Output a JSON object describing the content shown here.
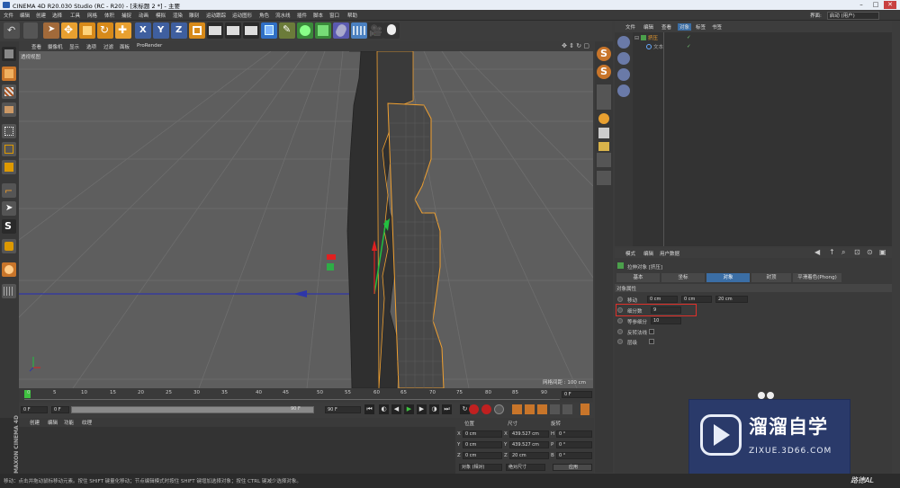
{
  "window": {
    "title": "CINEMA 4D R20.030 Studio (RC - R20) - [未标题 2 *] - 主要"
  },
  "menu": [
    "文件",
    "编辑",
    "创建",
    "选择",
    "工具",
    "网格",
    "体积",
    "捕捉",
    "动画",
    "模拟",
    "渲染",
    "雕刻",
    "运动跟踪",
    "运动图形",
    "角色",
    "流水线",
    "插件",
    "脚本",
    "窗口",
    "帮助"
  ],
  "layout": {
    "label": "界面:",
    "value": "启动 (用户)"
  },
  "viewport": {
    "menu": [
      "查看",
      "摄像机",
      "显示",
      "选项",
      "过滤",
      "面板",
      "ProRender"
    ],
    "label": "透视视图",
    "scale": "网格间距 : 100 cm"
  },
  "timeline": {
    "ticks": [
      "0",
      "5",
      "10",
      "15",
      "20",
      "25",
      "30",
      "35",
      "40",
      "45",
      "50",
      "55",
      "60",
      "65",
      "70",
      "75",
      "80",
      "85",
      "90"
    ],
    "end_frame": "0 F"
  },
  "transport": {
    "start": "0 F",
    "current": "0 F",
    "end": "90 F",
    "end2": "90 F"
  },
  "material": {
    "menu": [
      "创建",
      "编辑",
      "功能",
      "纹理"
    ]
  },
  "coords": {
    "headers": [
      "位置",
      "尺寸",
      "旋转"
    ],
    "rows": [
      {
        "axis": "X",
        "pos": "0 cm",
        "size": "439.527 cm",
        "rot_axis": "H",
        "rot": "0 °"
      },
      {
        "axis": "Y",
        "pos": "0 cm",
        "size": "439.527 cm",
        "rot_axis": "P",
        "rot": "0 °"
      },
      {
        "axis": "Z",
        "pos": "0 cm",
        "size": "20 cm",
        "rot_axis": "B",
        "rot": "0 °"
      }
    ],
    "mode": "对象 (相对)",
    "size_mode": "绝对尺寸",
    "apply": "应用"
  },
  "object_manager": {
    "menu": [
      "文件",
      "编辑",
      "查看",
      "对象",
      "标签",
      "书签"
    ],
    "objects": [
      {
        "name": "挤压"
      },
      {
        "name": "文本"
      }
    ]
  },
  "attributes": {
    "menu": [
      "模式",
      "编辑",
      "用户数据"
    ],
    "title": "拉伸对象 [挤压]",
    "tabs": [
      "基本",
      "坐标",
      "对象",
      "封顶",
      "平滑着色(Phong)"
    ],
    "section": "对象属性",
    "fields": [
      {
        "label": "移动",
        "values": [
          "0 cm",
          "0 cm",
          "20 cm"
        ]
      },
      {
        "label": "细分数",
        "value": "9"
      },
      {
        "label": "等参细分",
        "value": "10"
      },
      {
        "label": "反转法线",
        "value": ""
      },
      {
        "label": "层级",
        "value": ""
      }
    ]
  },
  "status": "移动：点击并拖动鼠标移动元素。按住 SHIFT 键量化移动；节点编辑模式时按住 SHIFT 键增加选择对象；按住 CTRL 键减少选择对象。",
  "brand": "MAXON CINEMA 4D",
  "watermark": {
    "title": "溜溜自学",
    "url": "ZIXUE.3D66.COM"
  },
  "signature": "路德AL",
  "colors": {
    "accent": "#f5a623",
    "selection_tab": "#3b6ea5",
    "highlight_box": "#e0302a"
  }
}
